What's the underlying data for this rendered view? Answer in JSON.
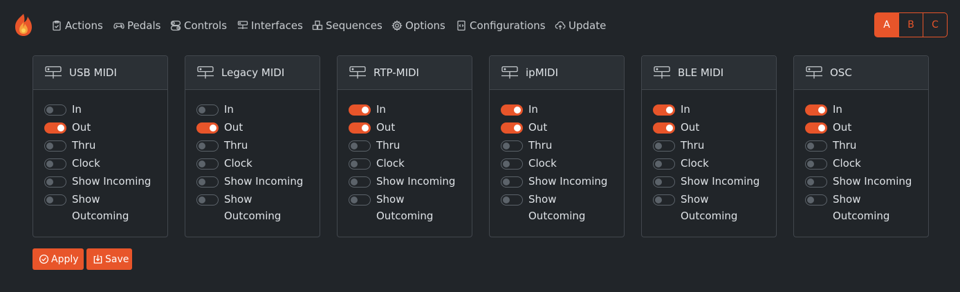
{
  "nav": {
    "items": [
      {
        "label": "Actions",
        "icon": "clipboard-check-icon"
      },
      {
        "label": "Pedals",
        "icon": "gamepad-icon"
      },
      {
        "label": "Controls",
        "icon": "toggles-icon"
      },
      {
        "label": "Interfaces",
        "icon": "hdd-network-icon"
      },
      {
        "label": "Sequences",
        "icon": "boxes-icon"
      },
      {
        "label": "Options",
        "icon": "gear-icon"
      },
      {
        "label": "Configurations",
        "icon": "file-code-icon"
      },
      {
        "label": "Update",
        "icon": "cloud-upload-icon"
      }
    ]
  },
  "profiles": {
    "items": [
      "A",
      "B",
      "C"
    ],
    "selected": "A"
  },
  "option_labels": [
    "In",
    "Out",
    "Thru",
    "Clock",
    "Show Incoming",
    "Show Outcoming"
  ],
  "interfaces": [
    {
      "name": "USB MIDI",
      "states": [
        false,
        true,
        false,
        false,
        false,
        false
      ]
    },
    {
      "name": "Legacy MIDI",
      "states": [
        false,
        true,
        false,
        false,
        false,
        false
      ]
    },
    {
      "name": "RTP-MIDI",
      "states": [
        true,
        true,
        false,
        false,
        false,
        false
      ]
    },
    {
      "name": "ipMIDI",
      "states": [
        true,
        true,
        false,
        false,
        false,
        false
      ]
    },
    {
      "name": "BLE MIDI",
      "states": [
        true,
        true,
        false,
        false,
        false,
        false
      ]
    },
    {
      "name": "OSC",
      "states": [
        true,
        true,
        false,
        false,
        false,
        false
      ]
    }
  ],
  "actions": {
    "apply_label": "Apply",
    "save_label": "Save"
  },
  "colors": {
    "accent": "#e8552a",
    "background": "#212529",
    "card_header": "#2b3035"
  }
}
